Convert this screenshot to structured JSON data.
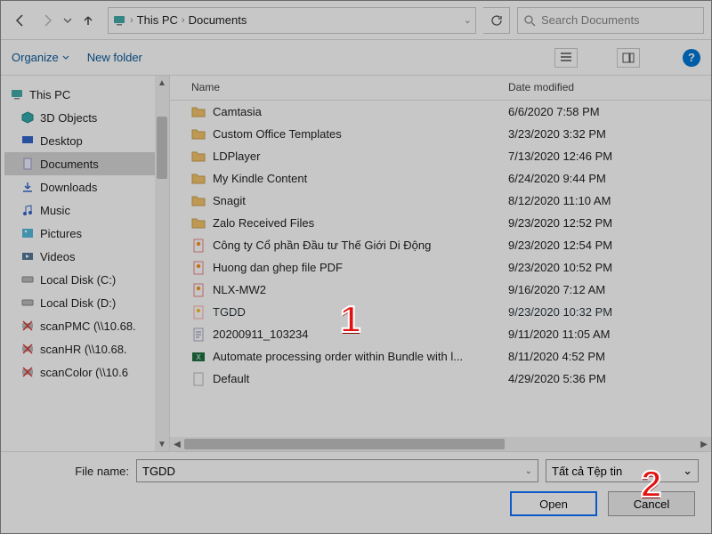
{
  "annotations": {
    "one": "1",
    "two": "2"
  },
  "nav": {
    "crumbs": [
      "This PC",
      "Documents"
    ],
    "search_placeholder": "Search Documents"
  },
  "toolbar": {
    "organize": "Organize",
    "newfolder": "New folder"
  },
  "tree": {
    "root": "This PC",
    "items": [
      {
        "label": "3D Objects",
        "icon": "cube"
      },
      {
        "label": "Desktop",
        "icon": "screen"
      },
      {
        "label": "Documents",
        "icon": "doc",
        "selected": true
      },
      {
        "label": "Downloads",
        "icon": "down"
      },
      {
        "label": "Music",
        "icon": "music"
      },
      {
        "label": "Pictures",
        "icon": "pic"
      },
      {
        "label": "Videos",
        "icon": "video"
      },
      {
        "label": "Local Disk (C:)",
        "icon": "disk"
      },
      {
        "label": "Local Disk (D:)",
        "icon": "disk"
      },
      {
        "label": "scanPMC (\\\\10.68.",
        "icon": "netx"
      },
      {
        "label": "scanHR (\\\\10.68.",
        "icon": "netx"
      },
      {
        "label": "scanColor (\\\\10.6",
        "icon": "netx"
      }
    ]
  },
  "columns": {
    "name": "Name",
    "date": "Date modified"
  },
  "files": [
    {
      "name": "Camtasia",
      "date": "6/6/2020 7:58 PM",
      "icon": "folder"
    },
    {
      "name": "Custom Office Templates",
      "date": "3/23/2020 3:32 PM",
      "icon": "folder"
    },
    {
      "name": "LDPlayer",
      "date": "7/13/2020 12:46 PM",
      "icon": "folder"
    },
    {
      "name": "My Kindle Content",
      "date": "6/24/2020 9:44 PM",
      "icon": "folder"
    },
    {
      "name": "Snagit",
      "date": "8/12/2020 11:10 AM",
      "icon": "folder"
    },
    {
      "name": "Zalo Received Files",
      "date": "9/23/2020 12:52 PM",
      "icon": "folder"
    },
    {
      "name": "Công ty Cổ phần Đầu tư Thế Giới Di Động",
      "date": "9/23/2020 12:54 PM",
      "icon": "doc2"
    },
    {
      "name": "Huong dan ghep file PDF",
      "date": "9/23/2020 10:52 PM",
      "icon": "doc2"
    },
    {
      "name": "NLX-MW2",
      "date": "9/16/2020 7:12 AM",
      "icon": "doc2"
    },
    {
      "name": "TGDD",
      "date": "9/23/2020 10:32 PM",
      "icon": "doc2",
      "selected": true
    },
    {
      "name": "20200911_103234",
      "date": "9/11/2020 11:05 AM",
      "icon": "txt"
    },
    {
      "name": "Automate processing order within Bundle with l...",
      "date": "8/11/2020 4:52 PM",
      "icon": "xls"
    },
    {
      "name": "Default",
      "date": "4/29/2020 5:36 PM",
      "icon": "file"
    }
  ],
  "footer": {
    "filename_label": "File name:",
    "filename_value": "TGDD",
    "filetype": "Tất cả Tệp tin",
    "open": "Open",
    "cancel": "Cancel"
  }
}
